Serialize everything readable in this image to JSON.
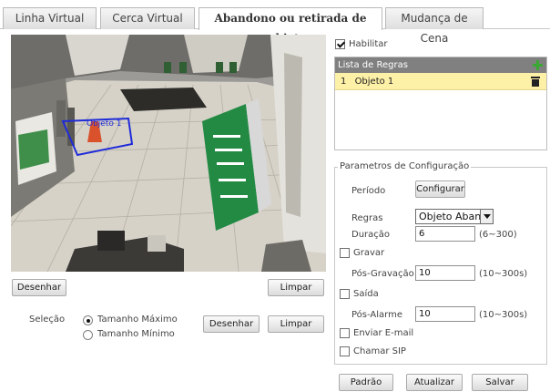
{
  "tabs": [
    {
      "label": "Linha Virtual"
    },
    {
      "label": "Cerca Virtual"
    },
    {
      "label": "Abandono ou retirada de objetos"
    },
    {
      "label": "Mudança de Cena"
    }
  ],
  "video": {
    "rule_label": "Objeto 1",
    "rule_color": "#1f2bd8"
  },
  "left": {
    "draw_button": "Desenhar",
    "clear_button": "Limpar",
    "selection_label": "Seleção",
    "size_options": [
      "Tamanho Máximo",
      "Tamanho Mínimo"
    ],
    "selected_size": "Tamanho Máximo",
    "draw_button2": "Desenhar",
    "clear_button2": "Limpar"
  },
  "right": {
    "enable_label": "Habilitar",
    "enable_checked": true,
    "rules_header": "Lista de Regras",
    "rules": [
      {
        "index": "1",
        "name": "Objeto 1"
      }
    ],
    "config_title": "Parametros de Configuração",
    "period_label": "Período",
    "configure_button": "Configurar",
    "rules_label": "Regras",
    "rules_value": "Objeto Abandonado",
    "duration_label": "Duração",
    "duration_value": "6",
    "duration_range": "(6~300)",
    "record_label": "Gravar",
    "post_record_label": "Pós-Gravação",
    "post_record_value": "10",
    "post_record_range": "(10~300s)",
    "output_label": "Saída",
    "post_alarm_label": "Pós-Alarme",
    "post_alarm_value": "10",
    "post_alarm_range": "(10~300s)",
    "email_label": "Enviar E-mail",
    "sip_label": "Chamar SIP",
    "default_button": "Padrão",
    "refresh_button": "Atualizar",
    "save_button": "Salvar",
    "accent_add": "#3aa832",
    "rule_highlight": "#fdf0a7"
  }
}
